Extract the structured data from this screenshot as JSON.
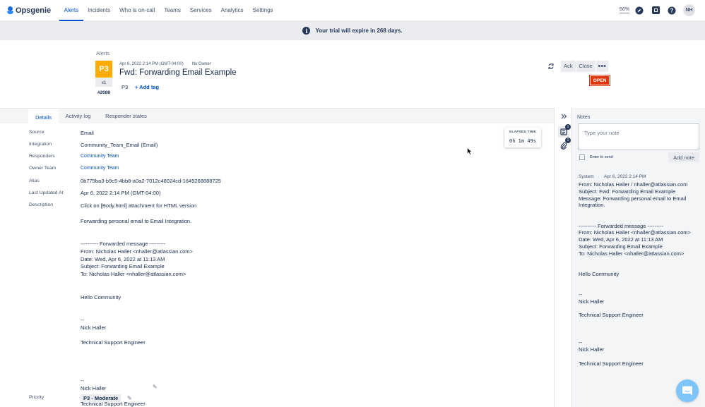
{
  "app": {
    "name": "Opsgenie",
    "brand_color": "#0052CC",
    "logo_colors": [
      "#1c6ddb",
      "#2684FF"
    ]
  },
  "nav": {
    "items": [
      {
        "label": "Alerts",
        "active": true
      },
      {
        "label": "Incidents",
        "active": false
      },
      {
        "label": "Who is on-call",
        "active": false
      },
      {
        "label": "Teams",
        "active": false
      },
      {
        "label": "Services",
        "active": false
      },
      {
        "label": "Analytics",
        "active": false
      },
      {
        "label": "Settings",
        "active": false
      }
    ],
    "progress_label": "66%",
    "progress_value": 66,
    "icons": [
      "compass-icon",
      "apps-icon",
      "help-icon"
    ],
    "avatar_initials": "NH"
  },
  "banner": {
    "icon": "info-icon",
    "text": "Your trial will expire in 268 days."
  },
  "alert": {
    "breadcrumb": "Alerts",
    "priority_box": "P3",
    "priority_color": "#FFAB00",
    "count": "x1",
    "tiny_id": "#2088",
    "created_at": "Apr 6, 2022 2:14 PM (GMT-04:00)",
    "owner": "No Owner",
    "title": "Fwd: Forwarding Email Example",
    "priority_tag": "P3",
    "add_tag_label": "+ Add tag",
    "status": "OPEN",
    "status_color": "#DE350B"
  },
  "actions": {
    "ack": "Ack",
    "close": "Close",
    "more": "•••"
  },
  "tabs": [
    {
      "label": "Details",
      "active": true
    },
    {
      "label": "Activity log",
      "active": false
    },
    {
      "label": "Responder states",
      "active": false
    }
  ],
  "details": {
    "source": {
      "label": "Source",
      "value": "Email"
    },
    "integration": {
      "label": "Integration",
      "value": "Community_Team_Email (Email)"
    },
    "responders": {
      "label": "Responders",
      "value": "Community Team"
    },
    "owner_team": {
      "label": "Owner Team",
      "value": "Community Team"
    },
    "alias": {
      "label": "Alias",
      "value": "0b775ba3-b9c5-4bb8-a0a2-7012c48024cd-1649268888725"
    },
    "last_updated": {
      "label": "Last Updated At",
      "value": "Apr 6, 2022 2:14 PM (GMT-04:00)"
    },
    "description_label": "Description",
    "description": "Click on [Body.html] attachment for HTML version\n\nForwarding personal email to Email Integration.\n\n\n---------- Forwarded message ---------\nFrom: Nicholas Haller <nhaller@atlassian.com>\nDate: Wed, Apr 6, 2022 at 11:13 AM\nSubject: Forwarding Email Example\nTo: Nicholas Haller <nhaller@atlassian.com>\n\n\nHello Community\n\n\n--\nNick Haller\n\nTechnical Support Engineer\n\n\n\n\n--\nNick Haller\n\nTechnical Support Engineer",
    "priority": {
      "label": "Priority",
      "value": "P3 - Moderate"
    }
  },
  "elapsed": {
    "label": "ELAPSED TIME",
    "value": "0h  1m  49s"
  },
  "rail": {
    "collapse_icon": "double-chevron-right-icon",
    "notes_icon": "notes-icon",
    "notes_count": "1",
    "attachments_icon": "paperclip-icon",
    "attachments_count": "1"
  },
  "notes": {
    "title": "Notes",
    "placeholder": "Type your note",
    "enter_to_send": "Enter to send",
    "add_note": "Add note",
    "entries": [
      {
        "author": "System",
        "time": "Apr 6, 2022 2:14 PM",
        "body": "From: Nicholas Haller / nhaller@atlassian.com\nSubject: Fwd: Forwarding Email Example\nMessage: Forwarding personal email to Email\nIntegration.\n\n\n---------- Forwarded message ---------\nFrom: Nicholas Haller <nhaller@atlassian.com>\nDate: Wed, Apr 6, 2022 at 11:13 AM\nSubject: Forwarding Email Example\nTo: Nicholas Haller <nhaller@atlassian.com>\n\n\nHello Community\n\n\n--\nNick Haller\n\nTechnical Support Engineer\n\n\n\n--\nNick Haller\n\nTechnical Support Engineer"
      }
    ]
  },
  "chat": {
    "icon": "chat-icon",
    "color": "#7cc4fa"
  }
}
